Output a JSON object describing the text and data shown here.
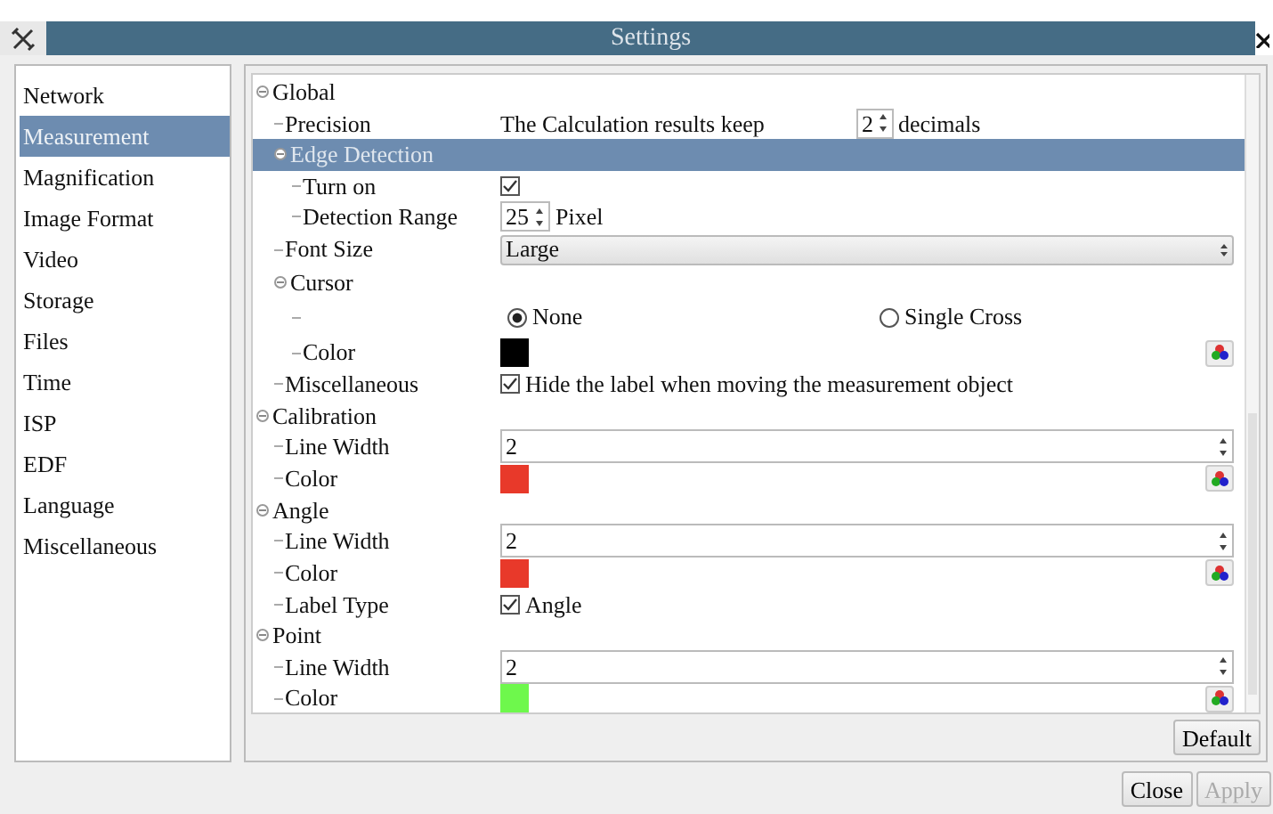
{
  "window": {
    "title": "Settings"
  },
  "sidebar": {
    "items": [
      {
        "label": "Network",
        "selected": false
      },
      {
        "label": "Measurement",
        "selected": true
      },
      {
        "label": "Magnification",
        "selected": false
      },
      {
        "label": "Image Format",
        "selected": false
      },
      {
        "label": "Video",
        "selected": false
      },
      {
        "label": "Storage",
        "selected": false
      },
      {
        "label": "Files",
        "selected": false
      },
      {
        "label": "Time",
        "selected": false
      },
      {
        "label": "ISP",
        "selected": false
      },
      {
        "label": "EDF",
        "selected": false
      },
      {
        "label": "Language",
        "selected": false
      },
      {
        "label": "Miscellaneous",
        "selected": false
      }
    ]
  },
  "tree": [
    {
      "label": "Global",
      "kind": "group",
      "expanded": true,
      "selected": false,
      "children": [
        {
          "label": "Precision",
          "kind": "spin_text",
          "prefix": "The Calculation results keep",
          "value": "2",
          "suffix": "decimals",
          "selected": false
        },
        {
          "label": "Edge Detection",
          "kind": "group",
          "expanded": true,
          "selected": true,
          "children": [
            {
              "label": "Turn on",
              "kind": "checkbox",
              "checked": true,
              "selected": false
            },
            {
              "label": "Detection Range",
              "kind": "spin",
              "value": "25",
              "suffix": "Pixel",
              "selected": false
            }
          ]
        },
        {
          "label": "Font Size",
          "kind": "select",
          "value": "Large",
          "selected": false
        },
        {
          "label": "Cursor",
          "kind": "group",
          "expanded": true,
          "selected": false,
          "children": [
            {
              "kind": "radio",
              "selected": false,
              "options": [
                {
                  "label": "None",
                  "selected": true
                },
                {
                  "label": "Single Cross",
                  "selected": false
                }
              ]
            },
            {
              "label": "Color",
              "kind": "color",
              "color": "#000000",
              "selected": false
            }
          ]
        },
        {
          "label": "Miscellaneous",
          "kind": "checkbox",
          "checked": true,
          "text": "Hide the label when moving the measurement object",
          "selected": false
        }
      ]
    },
    {
      "label": "Calibration",
      "kind": "group",
      "expanded": true,
      "selected": false,
      "children": [
        {
          "label": "Line Width",
          "kind": "number",
          "value": "2",
          "selected": false
        },
        {
          "label": "Color",
          "kind": "color",
          "color": "#e8392a",
          "selected": false
        }
      ]
    },
    {
      "label": "Angle",
      "kind": "group",
      "expanded": true,
      "selected": false,
      "children": [
        {
          "label": "Line Width",
          "kind": "number",
          "value": "2",
          "selected": false
        },
        {
          "label": "Color",
          "kind": "color",
          "color": "#e8392a",
          "selected": false
        },
        {
          "label": "Label Type",
          "kind": "checkbox",
          "checked": true,
          "text": "Angle",
          "selected": false
        }
      ]
    },
    {
      "label": "Point",
      "kind": "group",
      "expanded": true,
      "selected": false,
      "children": [
        {
          "label": "Line Width",
          "kind": "number",
          "value": "2",
          "selected": false
        },
        {
          "label": "Color",
          "kind": "color",
          "color": "#6ef84c",
          "selected": false
        }
      ]
    }
  ],
  "buttons": [
    {
      "label": "Default",
      "disabled": false
    },
    {
      "label": "Close",
      "disabled": false
    },
    {
      "label": "Apply",
      "disabled": true
    }
  ]
}
